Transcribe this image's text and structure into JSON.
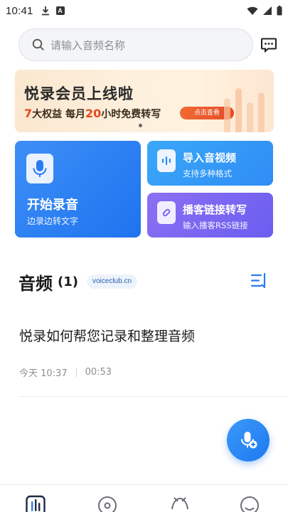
{
  "status_bar": {
    "time": "10:41"
  },
  "search": {
    "placeholder": "请输入音频名称"
  },
  "banner": {
    "title": "悦录会员上线啦",
    "benefit_count": "7",
    "benefit_text": "大权益  每月",
    "hours": "20",
    "hours_text": "小时免费转写",
    "button_label": "点击查看"
  },
  "actions": {
    "record": {
      "title": "开始录音",
      "subtitle": "边录边转文字"
    },
    "import": {
      "title": "导入音视频",
      "subtitle": "支持多种格式"
    },
    "podcast": {
      "title": "播客链接转写",
      "subtitle": "输入播客RSS链接"
    }
  },
  "audio_section": {
    "title": "音频",
    "count": "(1)",
    "tag": "voiceclub.cn",
    "items": [
      {
        "title": "悦录如何帮您记录和整理音频",
        "date": "今天 10:37",
        "duration": "00:53"
      }
    ]
  },
  "tabbar": {
    "items": [
      {
        "icon": "audio-wave-icon",
        "active": true
      },
      {
        "icon": "disc-icon",
        "active": false
      },
      {
        "icon": "podcast-icon",
        "active": false
      },
      {
        "icon": "profile-icon",
        "active": false
      }
    ]
  },
  "colors": {
    "primary": "#1f73ee",
    "accent_orange": "#e8491d",
    "purple": "#6a5ef0"
  }
}
